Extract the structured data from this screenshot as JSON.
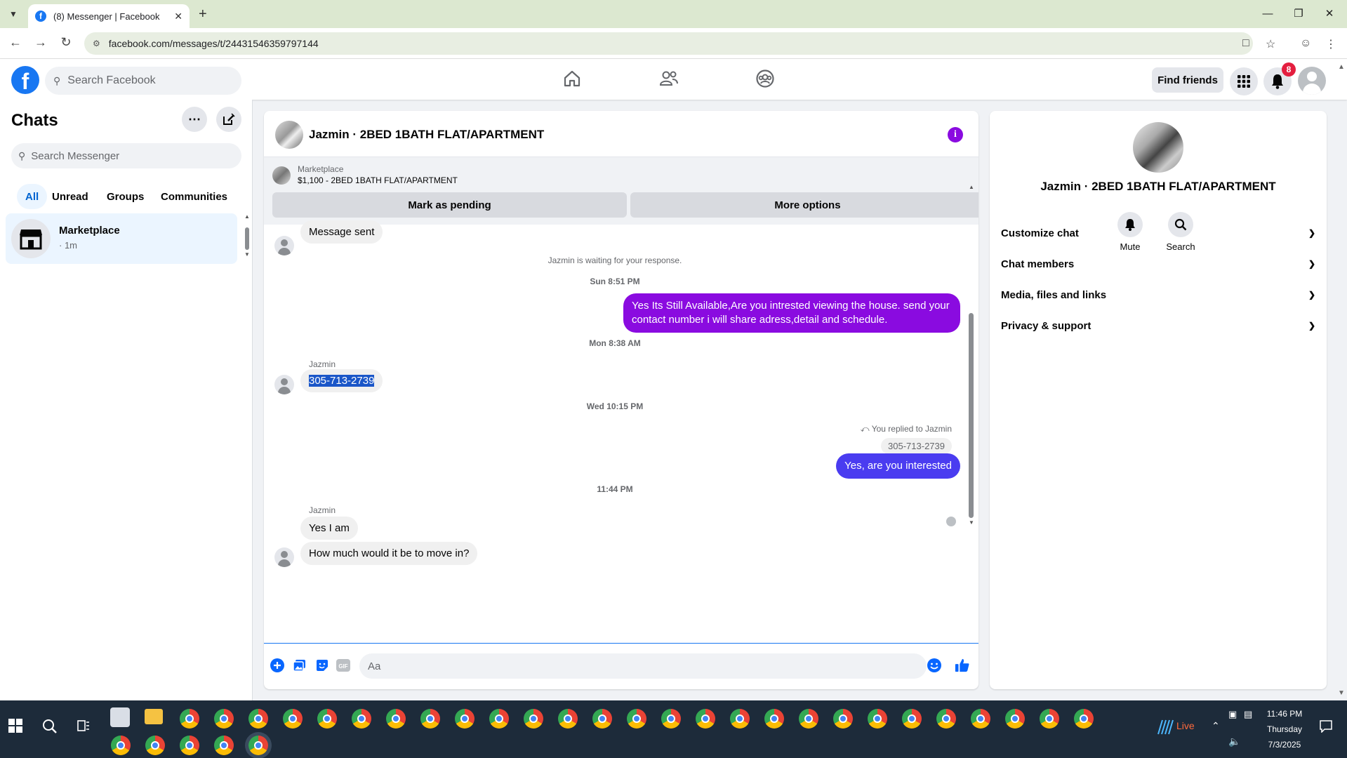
{
  "browser": {
    "tab_title": "(8) Messenger | Facebook",
    "url": "facebook.com/messages/t/24431546359797144"
  },
  "facebook": {
    "search_placeholder": "Search Facebook",
    "find_friends": "Find friends",
    "notification_count": "8"
  },
  "sidebar": {
    "title": "Chats",
    "search_placeholder": "Search Messenger",
    "filters": [
      "All",
      "Unread",
      "Groups",
      "Communities"
    ],
    "active_filter": "All",
    "chat_items": [
      {
        "name": "Marketplace",
        "time": "· 1m"
      }
    ]
  },
  "conversation": {
    "title": "Jazmin · 2BED 1BATH FLAT/APARTMENT",
    "marketplace_label": "Marketplace",
    "listing": "$1,100 - 2BED 1BATH FLAT/APARTMENT",
    "mark_pending": "Mark as pending",
    "more_options": "More options",
    "messages": {
      "sent_status": "Message sent",
      "waiting_note": "Jazmin is waiting for your response.",
      "stamp1": "Sun 8:51 PM",
      "out1": "Yes Its Still Available,Are you intrested viewing the house. send your contact number i will share adress,detail and schedule.",
      "stamp2": "Mon 8:38 AM",
      "sender1": "Jazmin",
      "in1": "305-713-2739",
      "stamp3": "Wed 10:15 PM",
      "reply_note": "You replied to Jazmin",
      "reply_quote": "305-713-2739",
      "out2": "Yes, are you interested",
      "stamp4": "11:44 PM",
      "sender2": "Jazmin",
      "in2": "Yes I am",
      "in3": "How much would it be to move in?"
    },
    "composer_placeholder": "Aa"
  },
  "info_panel": {
    "title": "Jazmin · 2BED 1BATH FLAT/APARTMENT",
    "actions": [
      "Mute",
      "Search"
    ],
    "sections": [
      "Customize chat",
      "Chat members",
      "Media, files and links",
      "Privacy & support"
    ]
  },
  "taskbar": {
    "live_label": "Live",
    "time": "11:46 PM",
    "day": "Thursday",
    "date": "7/3/2025"
  },
  "colors": {
    "facebook_blue": "#1877f2",
    "bubble_purple": "#8a0be0",
    "bubble_blue": "#4a3cf0",
    "selection_blue": "#1a56c8"
  }
}
